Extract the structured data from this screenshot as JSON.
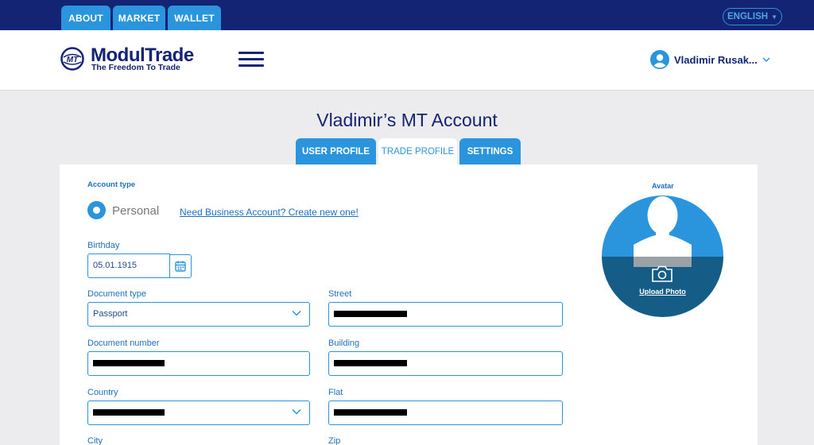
{
  "top_nav": {
    "tabs": [
      "ABOUT",
      "MARKET",
      "WALLET"
    ],
    "language": "ENGLISH"
  },
  "header": {
    "brand": "ModulTrade",
    "tagline": "The Freedom To Trade",
    "logo_mark": "MT",
    "user_name": "Vladimir Rusak..."
  },
  "page": {
    "title": "Vladimir’s MT Account",
    "tabs": [
      "USER PROFILE",
      "TRADE PROFILE",
      "SETTINGS"
    ]
  },
  "form": {
    "account_type_label": "Account type",
    "account_type_value": "Personal",
    "business_link": "Need Business Account? Create new one!",
    "birthday_label": "Birthday",
    "birthday_value": "05.01.1915",
    "document_type_label": "Document type",
    "document_type_value": "Passport",
    "street_label": "Street",
    "document_number_label": "Document number",
    "building_label": "Building",
    "country_label": "Country",
    "flat_label": "Flat",
    "city_label": "City",
    "zip_label": "Zip"
  },
  "avatar": {
    "label": "Avatar",
    "upload_label": "Upload Photo"
  },
  "colors": {
    "navy": "#142474",
    "accent": "#2a95dc",
    "avatar_dark": "#155d86"
  }
}
